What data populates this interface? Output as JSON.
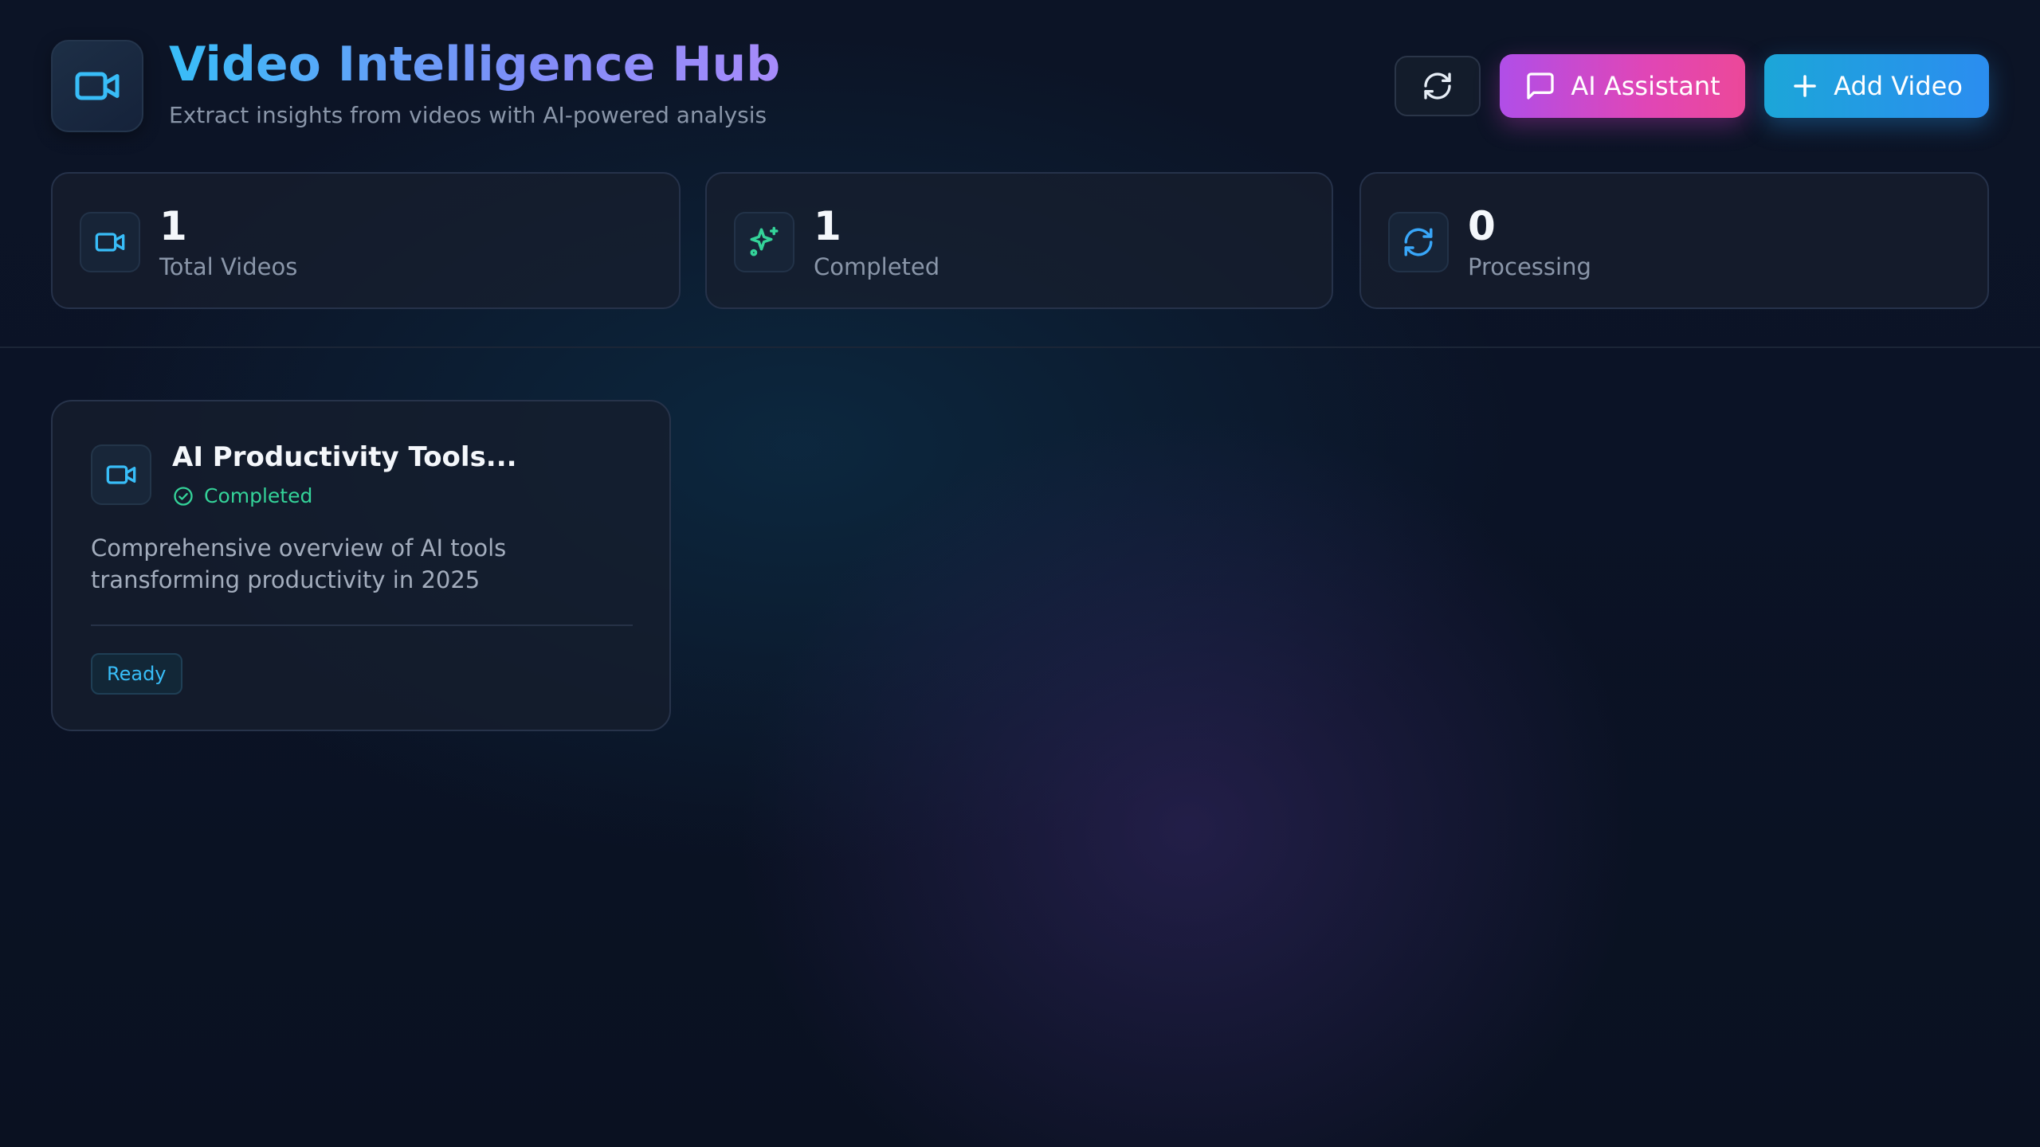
{
  "header": {
    "title": "Video Intelligence Hub",
    "subtitle": "Extract insights from videos with AI-powered analysis",
    "logo_icon": "video-camera-icon"
  },
  "actions": {
    "refresh_icon": "refresh-icon",
    "ai_assistant_label": "AI Assistant",
    "ai_assistant_icon": "chat-bubble-icon",
    "add_video_label": "Add Video",
    "add_video_icon": "plus-icon"
  },
  "stats": [
    {
      "value": "1",
      "label": "Total Videos",
      "icon": "video-camera-icon",
      "color": "#38bdf8"
    },
    {
      "value": "1",
      "label": "Completed",
      "icon": "sparkles-icon",
      "color": "#34d399"
    },
    {
      "value": "0",
      "label": "Processing",
      "icon": "refresh-icon",
      "color": "#38a6f8"
    }
  ],
  "videos": [
    {
      "title": "AI Productivity Tools...",
      "status": "Completed",
      "description": "Comprehensive overview of AI tools transforming productivity in 2025",
      "badge": "Ready"
    }
  ],
  "colors": {
    "accent_cyan": "#38bdf8",
    "accent_purple": "#a78bfa",
    "success": "#34d399",
    "ai_gradient": [
      "#b04ee8",
      "#ec4899"
    ],
    "add_gradient": [
      "#1ca6d8",
      "#2b8df0"
    ]
  }
}
